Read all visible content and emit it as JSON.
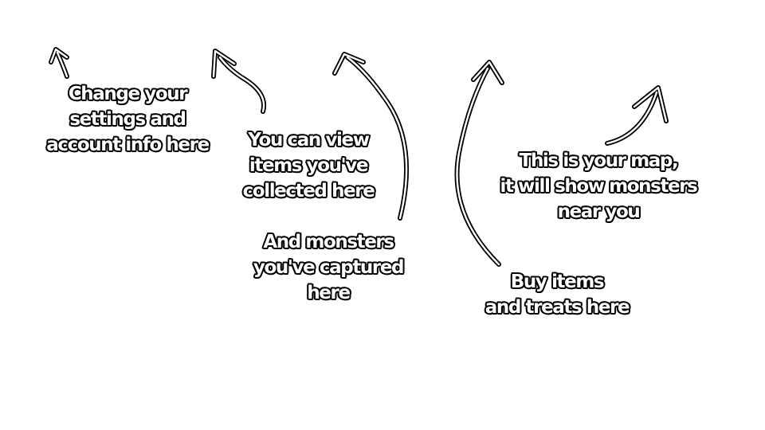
{
  "tips": {
    "settings": {
      "lines": [
        "Change your",
        "settings and",
        "account info here"
      ]
    },
    "items": {
      "lines": [
        "You can view",
        "items you've",
        "collected here"
      ]
    },
    "monsters": {
      "lines": [
        "And monsters",
        "you've captured",
        "here"
      ]
    },
    "shop": {
      "lines": [
        "Buy items",
        "and treats here"
      ]
    },
    "map": {
      "lines": [
        "This is your map,",
        "it will show monsters",
        "near you"
      ]
    }
  },
  "colors": {
    "background": "#ffffff",
    "text_fill": "#ffffff",
    "outline": "#000000"
  },
  "icons": [
    "arrow-up-icon",
    "curved-arrow-icon"
  ]
}
